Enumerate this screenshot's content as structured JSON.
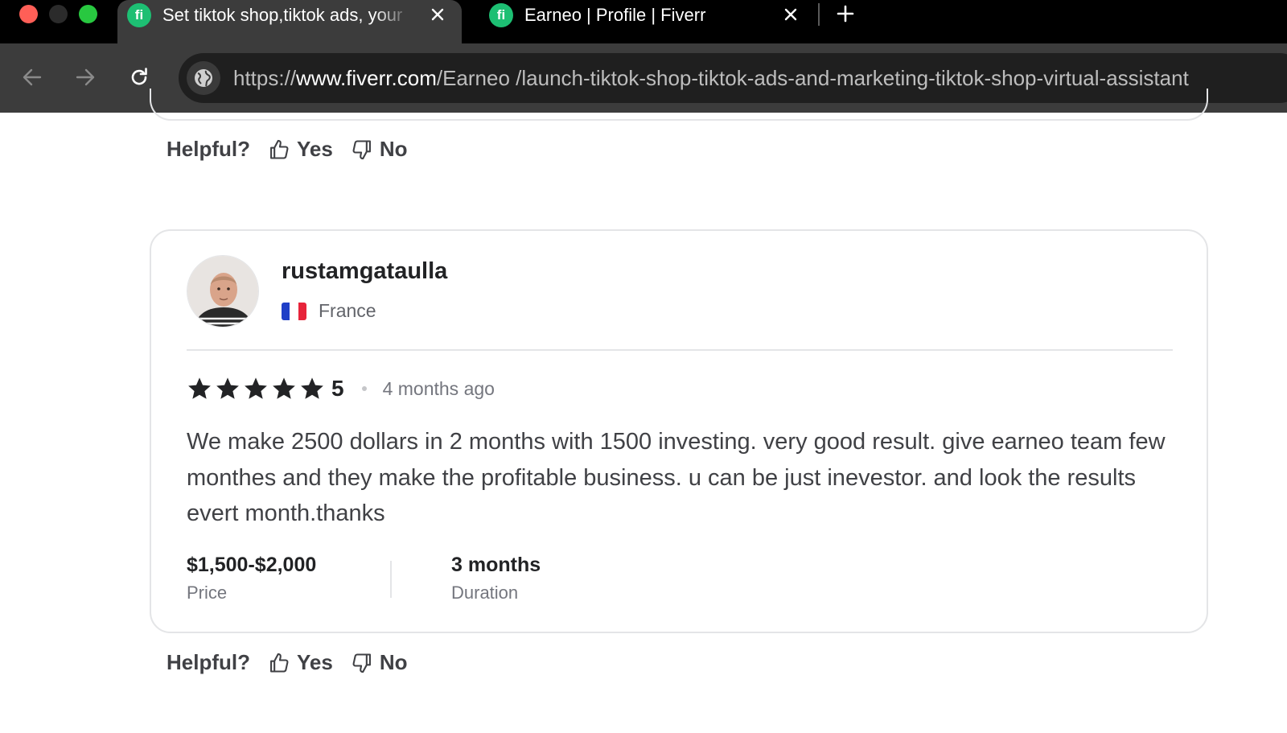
{
  "browser": {
    "tabs": [
      {
        "title": "Set tiktok shop,tiktok ads, your",
        "favicon": "fiverr-favicon",
        "favicon_text": "fi",
        "active": true
      },
      {
        "title": "Earneo | Profile | Fiverr",
        "favicon": "fiverr-favicon",
        "favicon_text": "fi",
        "active": false
      }
    ],
    "url_scheme": "https://",
    "url_host": "www.fiverr.com",
    "url_path": "/Earneo /launch-tiktok-shop-tiktok-ads-and-marketing-tiktok-shop-virtual-assistant"
  },
  "helpful_prev": {
    "label": "Helpful?",
    "yes": "Yes",
    "no": "No"
  },
  "review": {
    "username": "rustamgataulla",
    "country": "France",
    "rating": "5",
    "stars_filled": 5,
    "time_ago": "4 months ago",
    "text": "We make 2500 dollars in 2 months with 1500 investing. very good result. give earneo team few monthes and they make the profitable business. u can be just inevestor. and look the results evert month.thanks",
    "price_value": "$1,500-$2,000",
    "price_label": "Price",
    "duration_value": "3 months",
    "duration_label": "Duration"
  },
  "helpful": {
    "label": "Helpful?",
    "yes": "Yes",
    "no": "No"
  },
  "colors": {
    "fiverr_green": "#1dbf73",
    "text_dark": "#222325",
    "text_muted": "#74767e"
  }
}
